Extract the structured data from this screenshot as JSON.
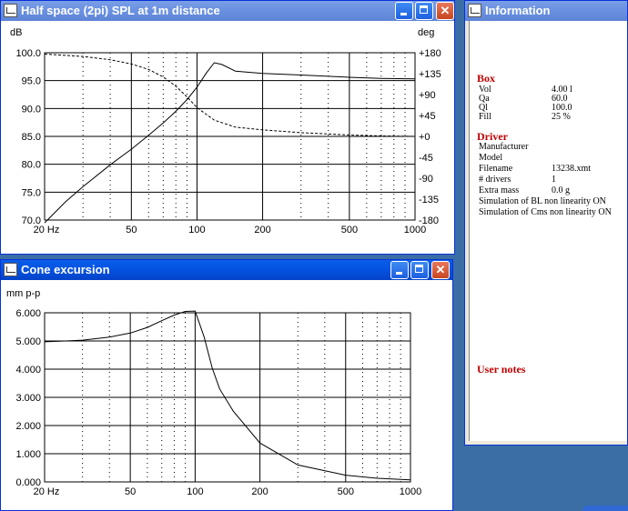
{
  "spl_window": {
    "title": "Half space (2pi) SPL at 1m distance",
    "left_unit": "dB",
    "right_unit": "deg",
    "y_ticks": [
      "100.0",
      "95.0",
      "90.0",
      "85.0",
      "80.0",
      "75.0",
      "70.0"
    ],
    "phase_ticks": [
      "+180",
      "+135",
      "+90",
      "+45",
      "+0",
      "-45",
      "-90",
      "-135",
      "-180"
    ],
    "x_ticks": [
      "20 Hz",
      "50",
      "100",
      "200",
      "500",
      "1000"
    ]
  },
  "cone_window": {
    "title": "Cone excursion",
    "unit": "mm p-p",
    "y_ticks": [
      "6.000",
      "5.000",
      "4.000",
      "3.000",
      "2.000",
      "1.000",
      "0.000"
    ],
    "x_ticks": [
      "20 Hz",
      "50",
      "100",
      "200",
      "500",
      "1000"
    ]
  },
  "info_window": {
    "title": "Information",
    "box_heading": "Box",
    "box_rows": [
      {
        "label": "Vol",
        "value": "4.00 l"
      },
      {
        "label": "Qa",
        "value": "60.0"
      },
      {
        "label": "Ql",
        "value": "100.0"
      },
      {
        "label": "Fill",
        "value": "25 %"
      }
    ],
    "driver_heading": "Driver",
    "driver_rows": [
      {
        "label": "Manufacturer",
        "value": ""
      },
      {
        "label": "Model",
        "value": ""
      },
      {
        "label": "Filename",
        "value": "13238.xmt"
      },
      {
        "label": "# drivers",
        "value": "1"
      },
      {
        "label": "Extra mass",
        "value": "0.0 g"
      }
    ],
    "notes": [
      "Simulation of BL non linearity ON",
      "Simulation of Cms non linearity ON"
    ],
    "user_notes_heading": "User notes"
  },
  "chart_data": [
    {
      "type": "line",
      "title": "Half space (2pi) SPL at 1m distance",
      "x_scale": "log",
      "xlim": [
        20,
        1000
      ],
      "ylabel": "dB",
      "ylim": [
        70,
        100
      ],
      "y2label": "deg",
      "y2lim": [
        -180,
        180
      ],
      "grid": true,
      "series": [
        {
          "role": "SPL",
          "axis": "left",
          "style": "solid",
          "x": [
            20,
            25,
            30,
            40,
            50,
            60,
            70,
            80,
            90,
            100,
            110,
            120,
            130,
            150,
            200,
            300,
            500,
            700,
            1000
          ],
          "y": [
            69.5,
            73.3,
            76.0,
            79.9,
            82.7,
            85.2,
            87.4,
            89.5,
            91.6,
            93.8,
            96.3,
            98.2,
            97.9,
            96.7,
            96.3,
            96.0,
            95.6,
            95.4,
            95.3
          ]
        },
        {
          "role": "Phase",
          "axis": "right",
          "style": "dashed",
          "x": [
            20,
            30,
            40,
            50,
            60,
            70,
            80,
            90,
            100,
            120,
            150,
            200,
            300,
            500,
            700,
            1000
          ],
          "y": [
            177,
            172,
            165,
            156,
            144,
            128,
            108,
            85,
            62,
            35,
            20,
            14,
            8,
            3,
            1,
            0
          ]
        }
      ]
    },
    {
      "type": "line",
      "title": "Cone excursion",
      "x_scale": "log",
      "xlim": [
        20,
        1000
      ],
      "ylabel": "mm p-p",
      "ylim": [
        0,
        6
      ],
      "grid": true,
      "series": [
        {
          "style": "solid",
          "x": [
            20,
            25,
            30,
            40,
            50,
            60,
            70,
            80,
            90,
            100,
            110,
            120,
            130,
            150,
            200,
            300,
            500,
            700,
            1000
          ],
          "y": [
            4.97,
            5.0,
            5.03,
            5.14,
            5.28,
            5.48,
            5.72,
            5.92,
            6.05,
            6.06,
            5.15,
            4.05,
            3.3,
            2.52,
            1.38,
            0.6,
            0.24,
            0.13,
            0.07
          ]
        }
      ]
    }
  ]
}
